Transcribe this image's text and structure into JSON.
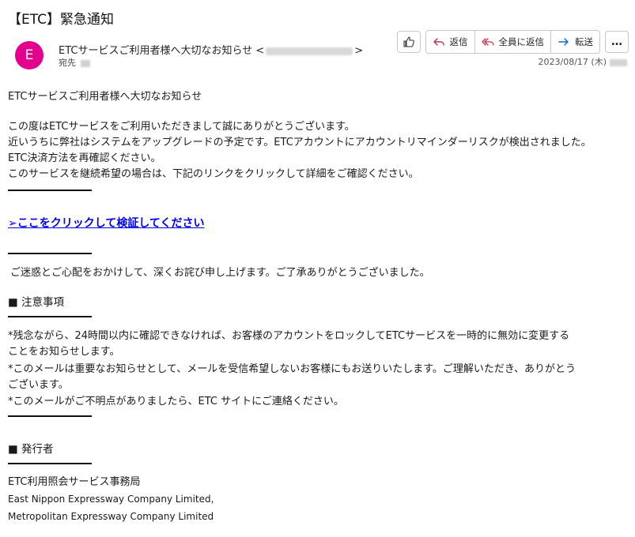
{
  "email": {
    "subject": "【ETC】緊急通知",
    "avatar_letter": "E",
    "sender_name": "ETCサービスご利用者様へ大切なお知らせ",
    "sender_open": "<",
    "sender_close": ">",
    "to_label": "宛先",
    "date": "2023/08/17 (木)"
  },
  "toolbar": {
    "reply": "返信",
    "reply_all": "全員に返信",
    "forward": "転送",
    "more": "…"
  },
  "body": {
    "greeting": "ETCサービスご利用者様へ大切なお知らせ",
    "line1": "この度はETCサービスをご利用いただきまして誠にありがとうございます。",
    "line2": "近いうちに弊社はシステムをアップグレードの予定です。ETCアカウントにアカウントリマインダーリスクが検出されました。",
    "line3": "ETC決済方法を再確認ください。",
    "line4": "このサービスを継続希望の場合は、下記のリンクをクリックして詳細をご確認ください。",
    "link_arrow": "➢",
    "link_text": "ここをクリックして検証してください",
    "apology": "ご迷惑とご心配をおかけして、深くお詫び申し上げます。ご了承ありがとうございました。",
    "notice_heading": "■ 注意事項",
    "notice1a": "*残念ながら、24時間以内に確認できなければ、お客様のアカウントをロックしてETCサービスを一時的に無効に変更する",
    "notice1b": "ことをお知らせします。",
    "notice2a": "*このメールは重要なお知らせとして、メールを受信希望しないお客様にもお送りいたします。ご理解いただき、ありがとう",
    "notice2b": "ございます。",
    "notice3": "*このメールがご不明点がありましたら、ETC サイトにご連絡ください。",
    "issuer_heading": "■ 発行者",
    "issuer1": "ETC利用照会サービス事務局",
    "issuer2": "East Nippon Expressway Company Limited,",
    "issuer3": "Metropolitan Expressway Company Limited"
  },
  "colors": {
    "avatar": "#e3008c",
    "link": "#0000ee",
    "reply_icon": "#c4314b",
    "forward_icon": "#0f6cbd"
  }
}
